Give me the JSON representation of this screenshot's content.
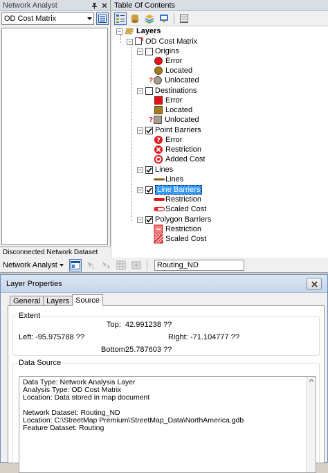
{
  "network_analyst": {
    "title": "Network Analyst",
    "selected_layer": "OD Cost Matrix",
    "status": "Disconnected Network Dataset"
  },
  "toc": {
    "title": "Table Of Contents",
    "root_label": "Layers",
    "od_layer": "OD Cost Matrix",
    "origins": "Origins",
    "origins_items": [
      "Error",
      "Located",
      "Unlocated"
    ],
    "destinations": "Destinations",
    "destinations_items": [
      "Error",
      "Located",
      "Unlocated"
    ],
    "point_barriers": "Point Barriers",
    "point_barriers_items": [
      "Error",
      "Restriction",
      "Added Cost"
    ],
    "lines": "Lines",
    "lines_items": [
      "Lines"
    ],
    "line_barriers": "Line Barriers",
    "line_barriers_items": [
      "Restriction",
      "Scaled Cost"
    ],
    "polygon_barriers": "Polygon Barriers",
    "polygon_barriers_items": [
      "Restriction",
      "Scaled Cost"
    ],
    "unlocated_marker": "?"
  },
  "na_toolbar": {
    "menu_label": "Network Analyst",
    "network_field": "Routing_ND"
  },
  "dialog": {
    "title": "Layer Properties",
    "tabs": [
      "General",
      "Layers",
      "Source"
    ],
    "active_tab": "Source",
    "extent": {
      "label": "Extent",
      "top_label": "Top:",
      "top_value": "42.991238 ??",
      "left_label": "Left:",
      "left_value": "-95.975788 ??",
      "right_label": "Right:",
      "right_value": "-71.104777 ??",
      "bottom_label": "Bottom:",
      "bottom_value": "25.787603 ??"
    },
    "data_source": {
      "label": "Data Source",
      "lines": [
        "Data Type: Network Analysis Layer",
        "Analysis Type: OD Cost Matrix",
        "Location: Data stored in map document",
        "",
        "Network Dataset: Routing_ND",
        "Location: C:\\StreetMap Premium\\StreetMap_Data\\NorthAmerica.gdb",
        "Feature Dataset: Routing"
      ]
    }
  },
  "colors": {
    "error_red": "#e8121a",
    "located_brown": "#a87c1a",
    "unlocated_gray": "#a89c8c",
    "line_brown": "#8b5a14",
    "barrier_red": "#e01818",
    "selection_blue": "#3399ff"
  }
}
